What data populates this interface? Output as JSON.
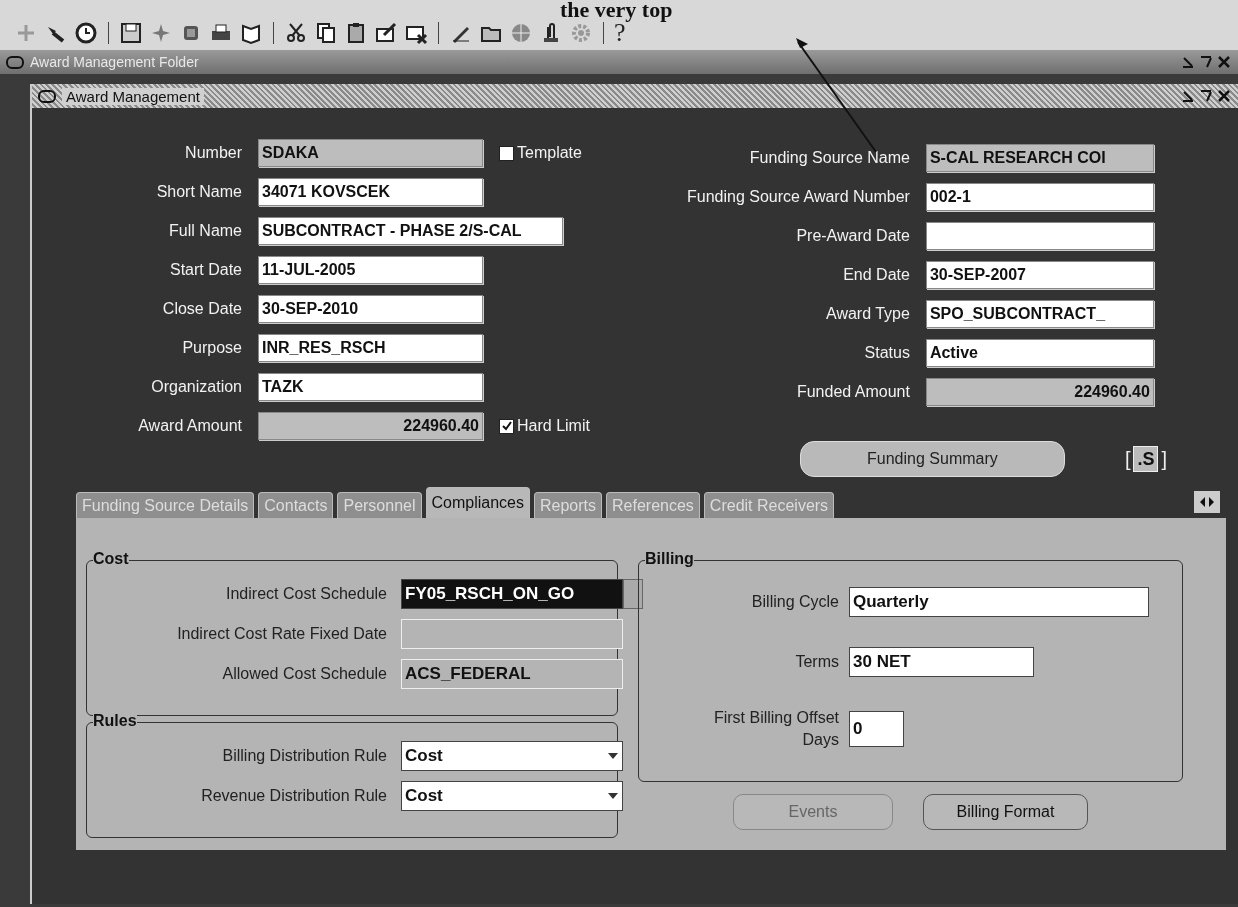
{
  "caption": "the very top",
  "toolbar": {
    "help": "?"
  },
  "folder_window": {
    "title": "Award Management Folder"
  },
  "window": {
    "title": "Award Management"
  },
  "left_fields": [
    {
      "label": "Number",
      "value": "SDAKA",
      "kind": "display"
    },
    {
      "label": "Short Name",
      "value": "34071 KOVSCEK",
      "kind": "text"
    },
    {
      "label": "Full Name",
      "value": "SUBCONTRACT - PHASE 2/S-CAL",
      "kind": "text"
    },
    {
      "label": "Start Date",
      "value": "11-JUL-2005",
      "kind": "text"
    },
    {
      "label": "Close Date",
      "value": "30-SEP-2010",
      "kind": "text"
    },
    {
      "label": "Purpose",
      "value": "INR_RES_RSCH",
      "kind": "text"
    },
    {
      "label": "Organization",
      "value": "TAZK",
      "kind": "text"
    },
    {
      "label": "Award Amount",
      "value": "224960.40",
      "kind": "amount"
    }
  ],
  "template": {
    "label": "Template",
    "checked": false
  },
  "hard_limit": {
    "label": "Hard Limit",
    "checked": true
  },
  "right_fields": [
    {
      "label": "Funding Source Name",
      "value": "S-CAL RESEARCH COI",
      "kind": "display"
    },
    {
      "label": "Funding Source Award Number",
      "value": "002-1",
      "kind": "text"
    },
    {
      "label": "Pre-Award Date",
      "kind": "text"
    },
    {
      "label": "End Date",
      "value": "30-SEP-2007",
      "kind": "text"
    },
    {
      "label": "Award Type",
      "value": "SPO_SUBCONTRACT_",
      "kind": "text"
    },
    {
      "label": "Status",
      "value": "Active",
      "kind": "text"
    },
    {
      "label": "Funded Amount",
      "value": "224960.40",
      "kind": "amount"
    }
  ],
  "funding_summary_button": "Funding Summary",
  "side_button": {
    "open": "[",
    "label": ".S",
    "close": "]"
  },
  "tabs": [
    {
      "label": "Funding Source Details",
      "selected": false
    },
    {
      "label": "Contacts",
      "selected": false
    },
    {
      "label": "Personnel",
      "selected": false
    },
    {
      "label": "Compliances",
      "selected": true
    },
    {
      "label": "Reports",
      "selected": false
    },
    {
      "label": "References",
      "selected": false
    },
    {
      "label": "Credit Receivers",
      "selected": false
    }
  ],
  "cost": {
    "title": "Cost",
    "fields": [
      {
        "label": "Indirect Cost Schedule",
        "value": "FY05_RSCH_ON_GO",
        "kind": "lov",
        "focused": true
      },
      {
        "label": "Indirect Cost Rate Fixed Date",
        "kind": "display",
        "focused": false
      },
      {
        "label": "Allowed Cost Schedule",
        "value": "ACS_FEDERAL",
        "kind": "display",
        "focused": false
      }
    ]
  },
  "rules": {
    "title": "Rules",
    "fields": [
      {
        "label": "Billing Distribution Rule",
        "value": "Cost",
        "kind": "select"
      },
      {
        "label": "Revenue Distribution Rule",
        "value": "Cost",
        "kind": "select"
      }
    ]
  },
  "billing": {
    "title": "Billing",
    "fields": [
      {
        "label": "Billing Cycle",
        "value": "Quarterly",
        "kind": "text"
      },
      {
        "label": "Terms",
        "value": "30 NET",
        "kind": "text"
      },
      {
        "label": "First Billing Offset Days",
        "value": "0",
        "kind": "text"
      }
    ]
  },
  "buttons": [
    {
      "label": "Events",
      "disabled": true
    },
    {
      "label": "Billing Format",
      "disabled": false
    }
  ]
}
